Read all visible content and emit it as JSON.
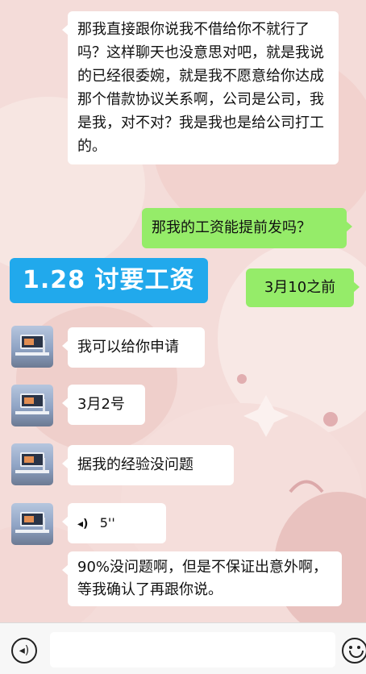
{
  "chat": {
    "messages": [
      {
        "side": "in",
        "text": "那我直接跟你说我不借给你不就行了吗？这样聊天也没意思对吧，就是我说的已经很委婉，就是我不愿意给你达成那个借款协议关系啊，公司是公司，我是我，对不对？我是我也是给公司打工的。"
      },
      {
        "side": "out",
        "text": "那我的工资能提前发吗？"
      },
      {
        "side": "out",
        "text": "3月10之前"
      },
      {
        "side": "in",
        "text": "我可以给你申请"
      },
      {
        "side": "in",
        "text": "3月2号"
      },
      {
        "side": "in",
        "text": "据我的经验没问题"
      },
      {
        "side": "in",
        "type": "voice",
        "duration": "5''",
        "icon": "voice-wave-icon"
      },
      {
        "side": "in",
        "text": "90%没问题啊，但是不保证出意外啊，等我确认了再跟你说。"
      }
    ]
  },
  "overlay": {
    "label": "1.28 讨要工资"
  },
  "input_bar": {
    "voice_icon": "voice-toggle-icon",
    "emoji_icon": "emoji-icon",
    "placeholder": ""
  },
  "colors": {
    "outgoing_bubble": "#95ec69",
    "incoming_bubble": "#ffffff",
    "label_badge": "#21a9ec",
    "background": "#f4dcd9"
  }
}
